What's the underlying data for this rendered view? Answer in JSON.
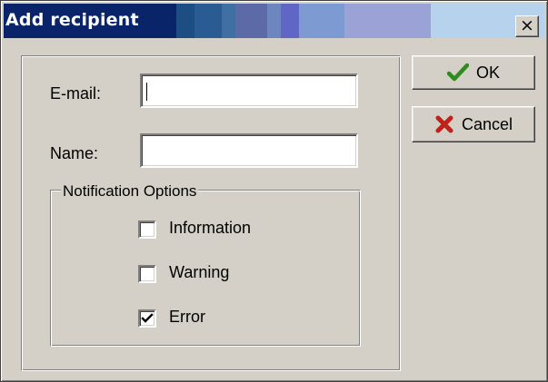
{
  "window": {
    "title": "Add recipient",
    "close_glyph": "×",
    "close_icon": "close-icon"
  },
  "form": {
    "email": {
      "label": "E-mail:",
      "value": "",
      "placeholder": ""
    },
    "name": {
      "label": "Name:",
      "value": "",
      "placeholder": ""
    }
  },
  "notification_options": {
    "legend": "Notification Options",
    "options": [
      {
        "label": "Information",
        "checked": false
      },
      {
        "label": "Warning",
        "checked": false
      },
      {
        "label": "Error",
        "checked": true
      }
    ]
  },
  "buttons": {
    "ok": {
      "label": "OK",
      "icon": "checkmark-icon",
      "icon_color": "#2e8b1f"
    },
    "cancel": {
      "label": "Cancel",
      "icon": "red-x-icon",
      "icon_color": "#c0221a"
    }
  },
  "colors": {
    "dialog_face": "#d4d0c8",
    "titlebar_start": "#0a246a",
    "titlebar_end": "#b7d2ec"
  }
}
